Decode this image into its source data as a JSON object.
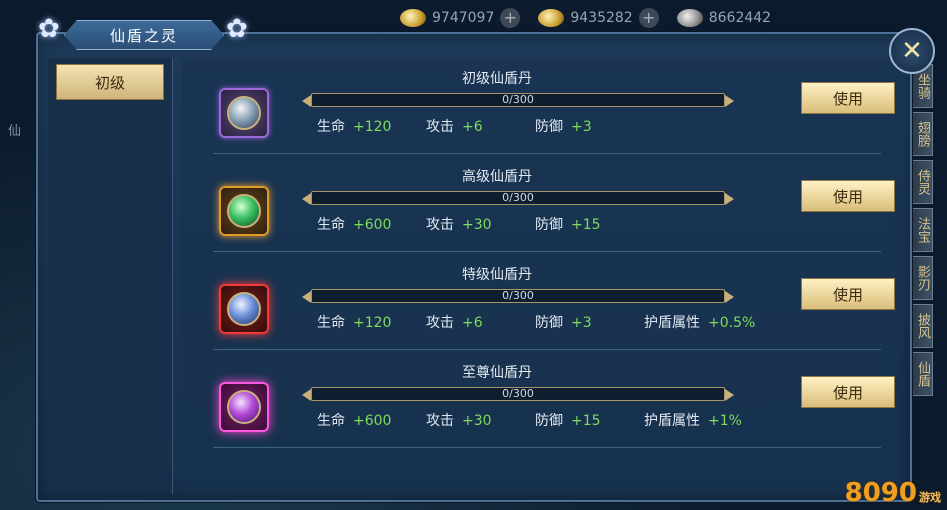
{
  "resources": [
    {
      "icon": "gold-ingot-icon",
      "value": "9747097"
    },
    {
      "icon": "silver-ingot-icon",
      "value": "9435282"
    },
    {
      "icon": "coin-icon",
      "value": "8662442"
    }
  ],
  "background_side_tabs": [
    "坐骑",
    "翅膀",
    "侍灵",
    "法宝",
    "影刃",
    "披风",
    "仙盾"
  ],
  "background_left_label": "仙",
  "panel": {
    "title": "仙盾之灵",
    "sidebar_tab": "初级"
  },
  "items": [
    {
      "name": "初级仙盾丹",
      "frame": "purple",
      "progress_text": "0/300",
      "progress": 0,
      "stats": [
        {
          "label": "生命",
          "value": "+120"
        },
        {
          "label": "攻击",
          "value": "+6"
        },
        {
          "label": "防御",
          "value": "+3"
        }
      ],
      "button": "使用"
    },
    {
      "name": "高级仙盾丹",
      "frame": "orange",
      "progress_text": "0/300",
      "progress": 0,
      "stats": [
        {
          "label": "生命",
          "value": "+600"
        },
        {
          "label": "攻击",
          "value": "+30"
        },
        {
          "label": "防御",
          "value": "+15"
        }
      ],
      "button": "使用"
    },
    {
      "name": "特级仙盾丹",
      "frame": "red",
      "progress_text": "0/300",
      "progress": 0,
      "stats": [
        {
          "label": "生命",
          "value": "+120"
        },
        {
          "label": "攻击",
          "value": "+6"
        },
        {
          "label": "防御",
          "value": "+3"
        },
        {
          "label": "护盾属性",
          "value": "+0.5%"
        }
      ],
      "button": "使用"
    },
    {
      "name": "至尊仙盾丹",
      "frame": "pink",
      "progress_text": "0/300",
      "progress": 0,
      "stats": [
        {
          "label": "生命",
          "value": "+600"
        },
        {
          "label": "攻击",
          "value": "+30"
        },
        {
          "label": "防御",
          "value": "+15"
        },
        {
          "label": "护盾属性",
          "value": "+1%"
        }
      ],
      "button": "使用"
    }
  ],
  "watermark": {
    "main": "8090",
    "sub": "游戏"
  },
  "colors": {
    "stat_value": "#7ddc5c",
    "accent_gold": "#d9be7a",
    "panel_bg": "#1e3a59"
  }
}
